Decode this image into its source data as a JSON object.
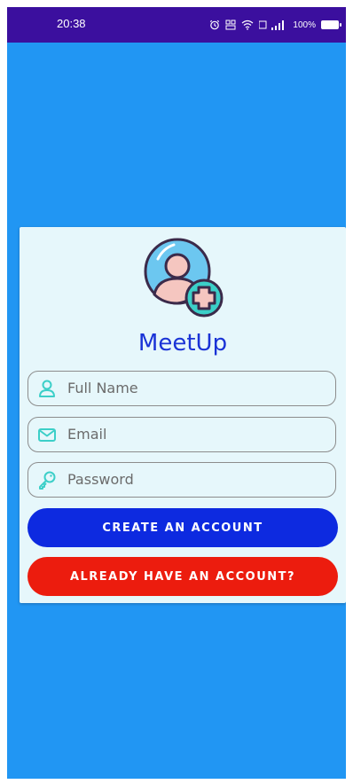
{
  "status_bar": {
    "time": "20:38",
    "battery_label": "100%",
    "icons": [
      "alarm-icon",
      "data-speed-icon",
      "wifi-icon",
      "signal-icon",
      "battery-icon"
    ]
  },
  "app": {
    "name": "MeetUp",
    "logo_icon": "add-user-icon"
  },
  "form": {
    "full_name": {
      "placeholder": "Full Name",
      "value": "",
      "icon": "person-icon"
    },
    "email": {
      "placeholder": "Email",
      "value": "",
      "icon": "mail-icon"
    },
    "password": {
      "placeholder": "Password",
      "value": "",
      "icon": "key-icon"
    }
  },
  "buttons": {
    "create_account": "CREATE AN ACCOUNT",
    "have_account": "ALREADY HAVE AN ACCOUNT?"
  },
  "colors": {
    "background": "#2196f3",
    "status_bar": "#3b0f9e",
    "card": "#e6f7fb",
    "title": "#1a33d6",
    "primary_button": "#0d2ae0",
    "secondary_button": "#ec1c0e",
    "icon_accent": "#3ccfc8"
  }
}
